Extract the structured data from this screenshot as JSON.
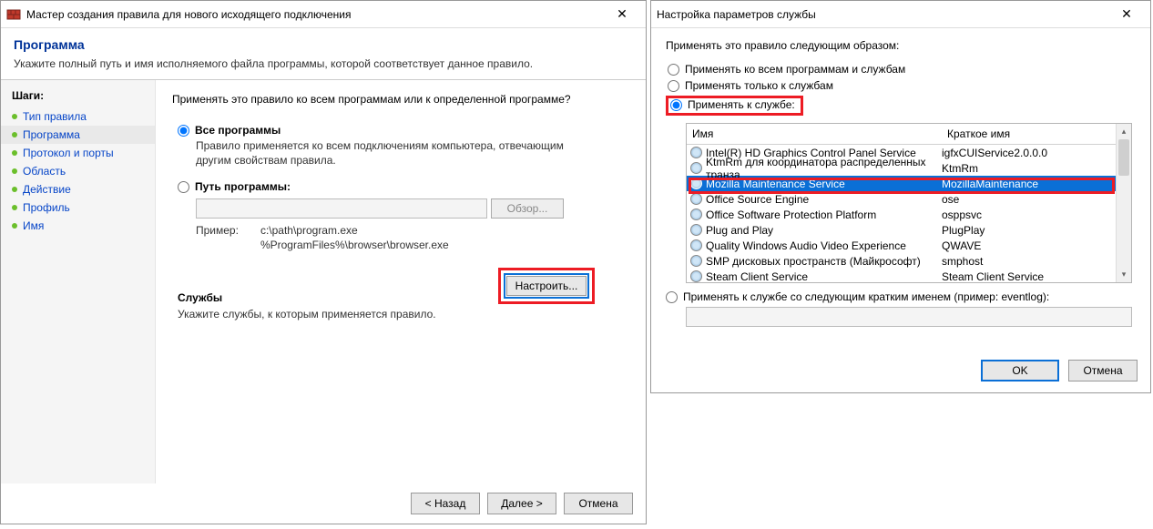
{
  "left": {
    "title": "Мастер создания правила для нового исходящего подключения",
    "heading": "Программа",
    "subheading": "Укажите полный путь и имя исполняемого файла программы, которой соответствует данное правило.",
    "sidebar_title": "Шаги:",
    "steps": [
      "Тип правила",
      "Программа",
      "Протокол и порты",
      "Область",
      "Действие",
      "Профиль",
      "Имя"
    ],
    "prompt": "Применять это правило ко всем программам или к определенной программе?",
    "radio_all": "Все программы",
    "radio_all_desc": "Правило применяется ко всем подключениям компьютера, отвечающим другим свойствам правила.",
    "radio_path": "Путь программы:",
    "browse": "Обзор...",
    "example_label": "Пример:",
    "example_line1": "c:\\path\\program.exe",
    "example_line2": "%ProgramFiles%\\browser\\browser.exe",
    "services_label": "Службы",
    "services_desc": "Укажите службы, к которым применяется правило.",
    "configure": "Настроить...",
    "back": "< Назад",
    "next": "Далее >",
    "cancel": "Отмена"
  },
  "right": {
    "title": "Настройка параметров службы",
    "intro": "Применять это правило следующим образом:",
    "r_all": "Применять ко всем программам и службам",
    "r_services_only": "Применять только к службам",
    "r_pick": "Применять к службе:",
    "col_name": "Имя",
    "col_short": "Краткое имя",
    "rows": [
      {
        "n": "Intel(R) HD Graphics Control Panel Service",
        "s": "igfxCUIService2.0.0.0"
      },
      {
        "n": "KtmRm для координатора распределенных транза",
        "s": "KtmRm"
      },
      {
        "n": "Mozilla Maintenance Service",
        "s": "MozillaMaintenance"
      },
      {
        "n": "Office  Source Engine",
        "s": "ose"
      },
      {
        "n": "Office Software Protection Platform",
        "s": "osppsvc"
      },
      {
        "n": "Plug and Play",
        "s": "PlugPlay"
      },
      {
        "n": "Quality Windows Audio Video Experience",
        "s": "QWAVE"
      },
      {
        "n": "SMP дисковых пространств (Майкрософт)",
        "s": "smphost"
      },
      {
        "n": "Steam Client Service",
        "s": "Steam Client Service"
      }
    ],
    "r_short": "Применять к службе со следующим кратким именем (пример: eventlog):",
    "ok": "OK",
    "cancel": "Отмена"
  }
}
